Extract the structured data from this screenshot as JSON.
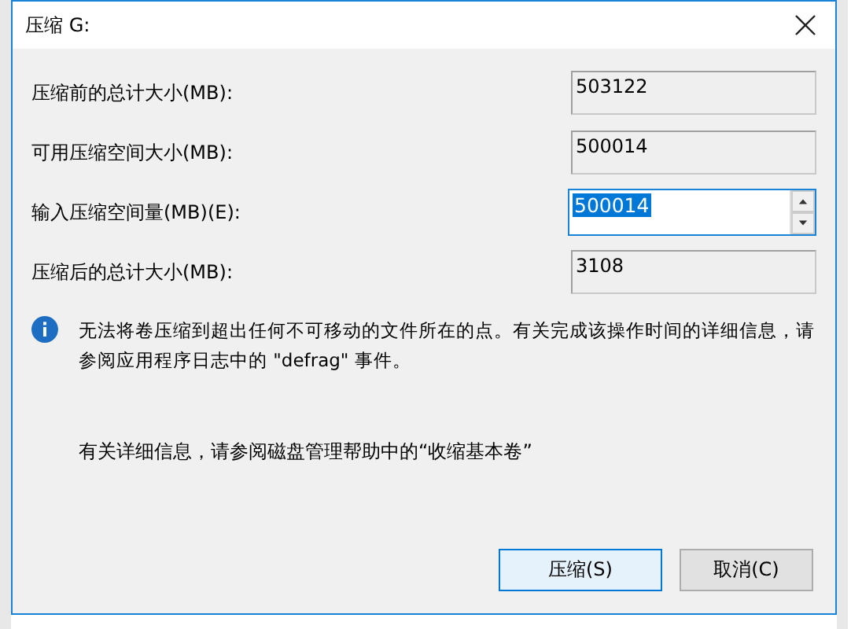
{
  "window": {
    "title": "压缩 G:"
  },
  "fields": [
    {
      "label": "压缩前的总计大小(MB):",
      "value": "503122",
      "kind": "readonly"
    },
    {
      "label": "可用压缩空间大小(MB):",
      "value": "500014",
      "kind": "readonly"
    },
    {
      "label": "输入压缩空间量(MB)(E):",
      "value": "500014",
      "kind": "spin",
      "selected": true
    },
    {
      "label": "压缩后的总计大小(MB):",
      "value": "3108",
      "kind": "readonly"
    }
  ],
  "info": {
    "text": "无法将卷压缩到超出任何不可移动的文件所在的点。有关完成该操作时间的详细信息，请参阅应用程序日志中的 \"defrag\" 事件。"
  },
  "help_text": "有关详细信息，请参阅磁盘管理帮助中的“收缩基本卷”",
  "buttons": [
    {
      "label": "压缩(S)",
      "default": true
    },
    {
      "label": "取消(C)",
      "default": false
    }
  ]
}
